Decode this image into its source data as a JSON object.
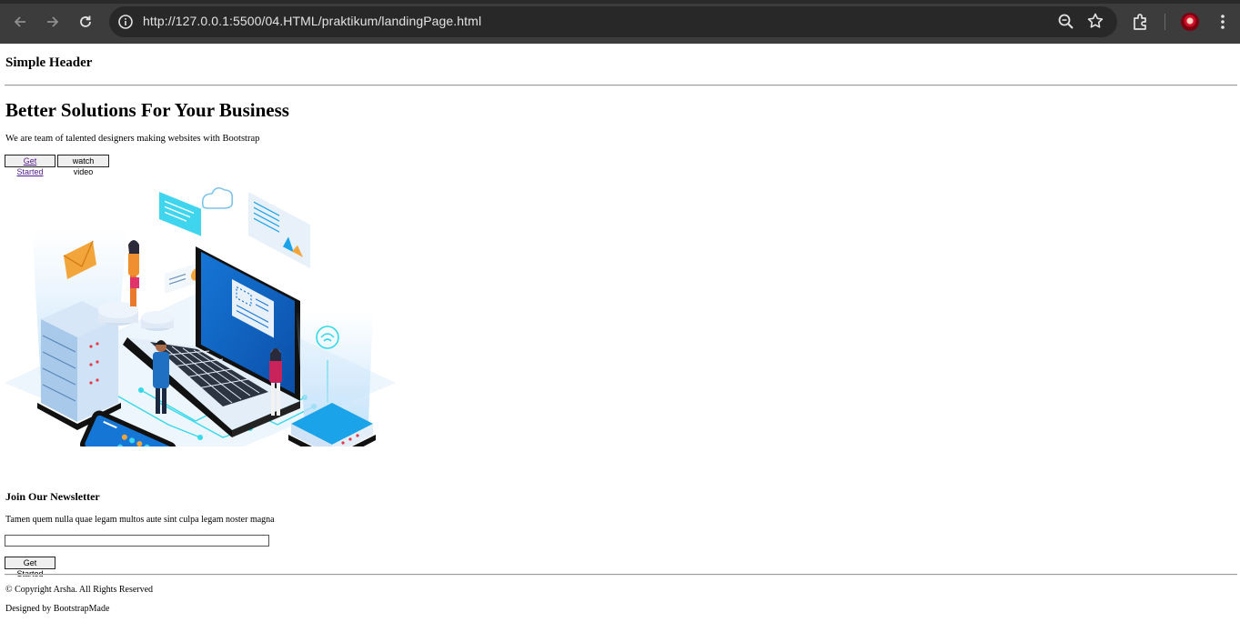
{
  "browser": {
    "url": "http://127.0.0.1:5500/04.HTML/praktikum/landingPage.html",
    "icons": [
      "back-arrow-icon",
      "forward-arrow-icon",
      "reload-icon",
      "site-info-icon",
      "zoom-icon",
      "bookmark-star-icon",
      "extensions-icon",
      "profile-avatar",
      "kebab-menu-icon"
    ]
  },
  "header": {
    "title": "Simple Header"
  },
  "hero": {
    "title": "Better Solutions For Your Business",
    "subtitle": "We are team of talented designers making websites with Bootstrap",
    "primary_button": "Get Started",
    "secondary_button": "watch video",
    "illustration": "isometric-business-technology-illustration"
  },
  "newsletter": {
    "title": "Join Our Newsletter",
    "text": "Tamen quem nulla quae legam multos aute sint culpa legam noster magna",
    "email_value": "",
    "submit_label": "Get Started"
  },
  "footer": {
    "copyright": "© Copyright Arsha. All Rights Reserved",
    "credits": "Designed by BootstrapMade"
  },
  "colors": {
    "chrome_bg": "#3c3c3c",
    "omnibox_bg": "#282828",
    "illustration_accent": "#1aa3e8",
    "illustration_cyan": "#2ee6f0",
    "visited_link": "#551a8b"
  }
}
